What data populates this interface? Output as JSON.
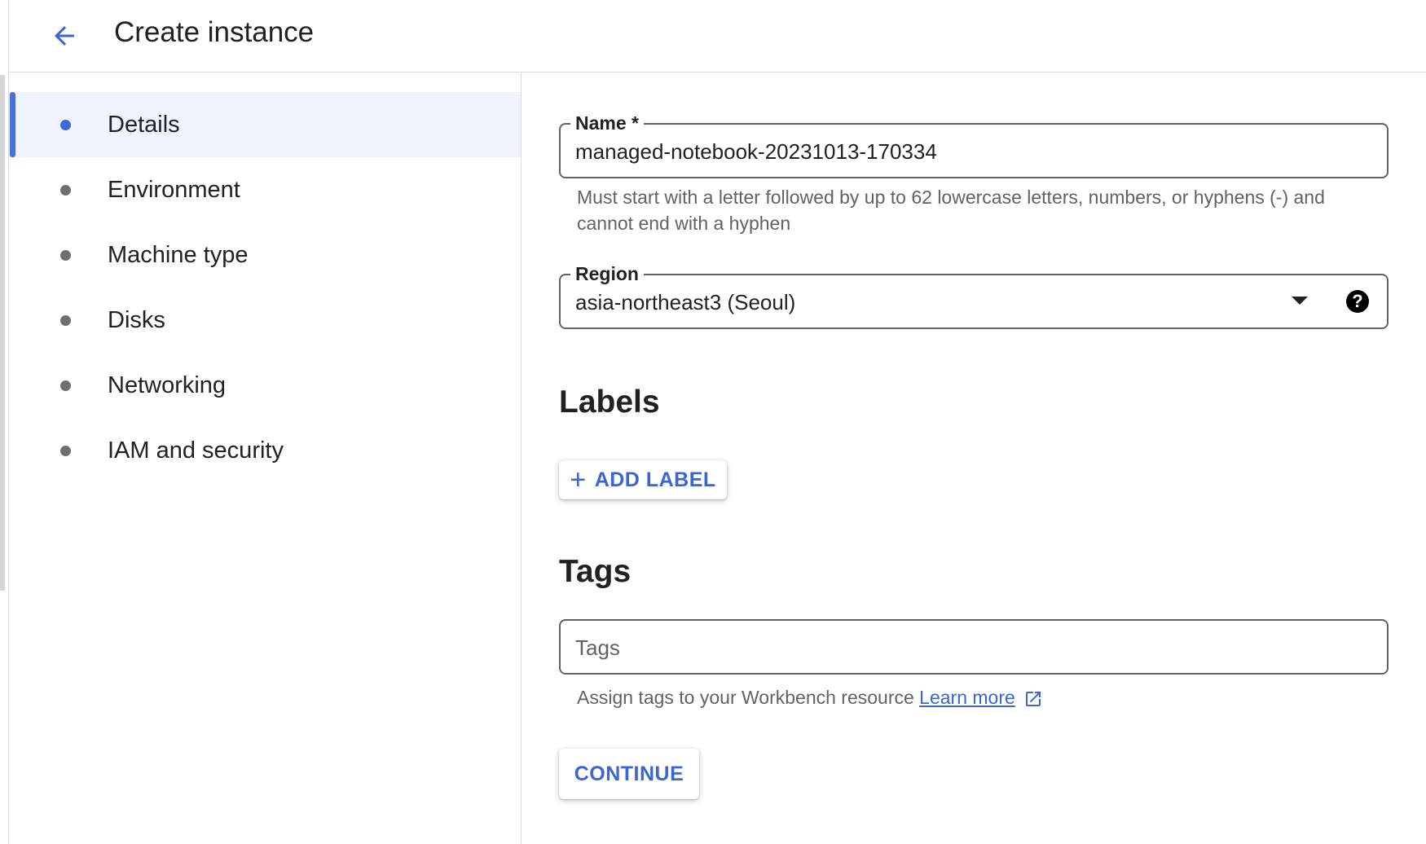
{
  "header": {
    "title": "Create instance",
    "back_icon": "arrow-back-icon"
  },
  "sidebar": {
    "items": [
      {
        "label": "Details",
        "active": true
      },
      {
        "label": "Environment",
        "active": false
      },
      {
        "label": "Machine type",
        "active": false
      },
      {
        "label": "Disks",
        "active": false
      },
      {
        "label": "Networking",
        "active": false
      },
      {
        "label": "IAM and security",
        "active": false
      }
    ]
  },
  "form": {
    "name": {
      "label": "Name *",
      "value": "managed-notebook-20231013-170334",
      "hint_line1": "Must start with a letter followed by up to 62 lowercase letters, numbers, or hyphens (-) and",
      "hint_line2": "cannot end with a hyphen"
    },
    "region": {
      "label": "Region",
      "value": "asia-northeast3 (Seoul)",
      "help_glyph": "?"
    },
    "labels": {
      "heading": "Labels",
      "add_button": "ADD LABEL",
      "add_glyph": "+"
    },
    "tags": {
      "heading": "Tags",
      "placeholder": "Tags",
      "hint": "Assign tags to your Workbench resource",
      "learn_more": "Learn more"
    },
    "continue_button": "CONTINUE"
  },
  "colors": {
    "accent": "#3b65d4",
    "active_bg": "#eef3fd",
    "border": "#5f6368",
    "divider": "#dadce0"
  }
}
